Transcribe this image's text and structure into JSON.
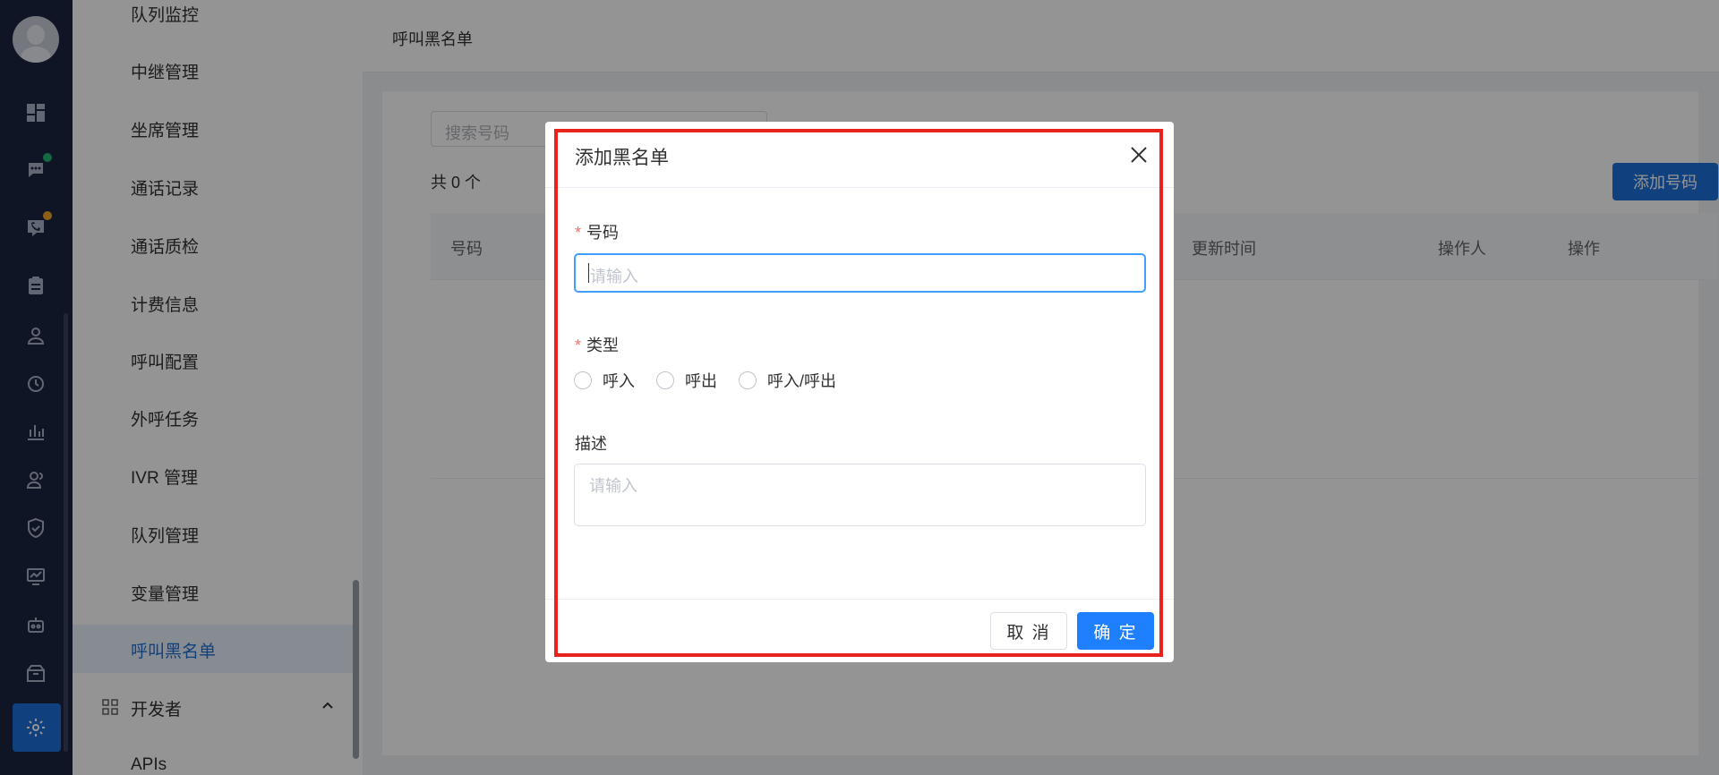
{
  "colors": {
    "rail_bg": "#1d2543",
    "accent": "#1e6fd9",
    "highlight_border": "#e8231e",
    "required_star": "#f56c6c"
  },
  "rail": {
    "icons": [
      "avatar",
      "dashboard-icon",
      "chat-icon",
      "phone-chat-icon",
      "clipboard-icon",
      "user-icon",
      "history-icon",
      "bar-chart-icon",
      "users-icon",
      "shield-icon",
      "monitor-chart-icon",
      "robot-icon",
      "package-icon",
      "gear-icon"
    ]
  },
  "submenu": {
    "items": [
      "队列监控",
      "中继管理",
      "坐席管理",
      "通话记录",
      "通话质检",
      "计费信息",
      "呼叫配置",
      "外呼任务",
      "IVR 管理",
      "队列管理",
      "变量管理",
      "呼叫黑名单"
    ],
    "active": "呼叫黑名单",
    "developer_group": "开发者",
    "apis": "APIs"
  },
  "page": {
    "breadcrumb": "呼叫黑名单",
    "search_placeholder": "搜索号码",
    "count_text": "共 0 个",
    "add_button": "添加号码",
    "columns": [
      "号码",
      "更新时间",
      "操作人",
      "操作"
    ]
  },
  "dialog": {
    "title": "添加黑名单",
    "number_label": "号码",
    "number_placeholder": "请输入",
    "type_label": "类型",
    "type_options": [
      "呼入",
      "呼出",
      "呼入/呼出"
    ],
    "desc_label": "描述",
    "desc_placeholder": "请输入",
    "cancel": "取 消",
    "confirm": "确 定"
  }
}
